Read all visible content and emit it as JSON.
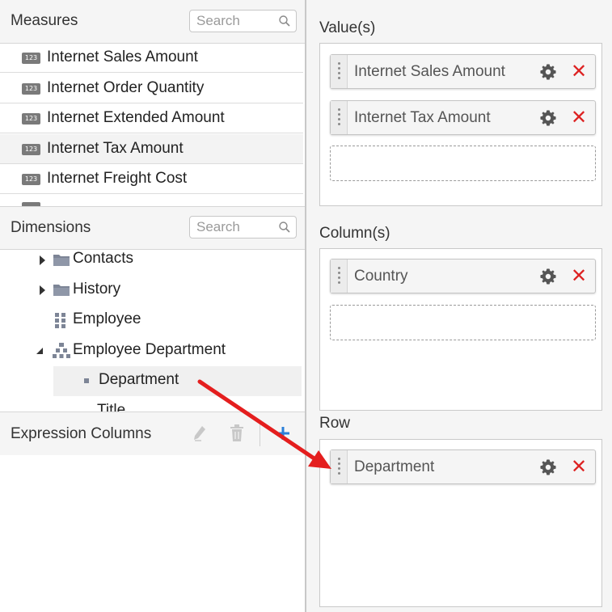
{
  "measures": {
    "title": "Measures",
    "search_placeholder": "Search",
    "items": [
      {
        "label": "Internet Sales Amount",
        "badge": "123"
      },
      {
        "label": "Internet Order Quantity",
        "badge": "123"
      },
      {
        "label": "Internet Extended Amount",
        "badge": "123"
      },
      {
        "label": "Internet Tax Amount",
        "badge": "123",
        "highlighted": true
      },
      {
        "label": "Internet Freight Cost",
        "badge": "123"
      }
    ]
  },
  "dimensions": {
    "title": "Dimensions",
    "search_placeholder": "Search",
    "items": [
      {
        "label": "Contacts",
        "icon": "folder-icon",
        "expandable": true
      },
      {
        "label": "History",
        "icon": "folder-icon",
        "expandable": true
      },
      {
        "label": "Employee",
        "icon": "grid-icon"
      },
      {
        "label": "Employee Department",
        "icon": "hierarchy-icon",
        "expanded": true
      },
      {
        "label": "Department",
        "icon": "level-icon",
        "selected": true
      }
    ]
  },
  "expression_columns": {
    "title": "Expression Columns",
    "icons": [
      "edit-icon",
      "delete-icon",
      "add-icon"
    ]
  },
  "values": {
    "label": "Value(s)",
    "items": [
      "Internet Sales Amount",
      "Internet Tax Amount"
    ]
  },
  "columns": {
    "label": "Column(s)",
    "items": [
      "Country"
    ]
  },
  "rows": {
    "label": "Row",
    "items": [
      "Department"
    ]
  },
  "colors": {
    "accent_blue": "#2b7fd9",
    "remove_red": "#d22222",
    "arrow_red": "#e41e1e"
  }
}
